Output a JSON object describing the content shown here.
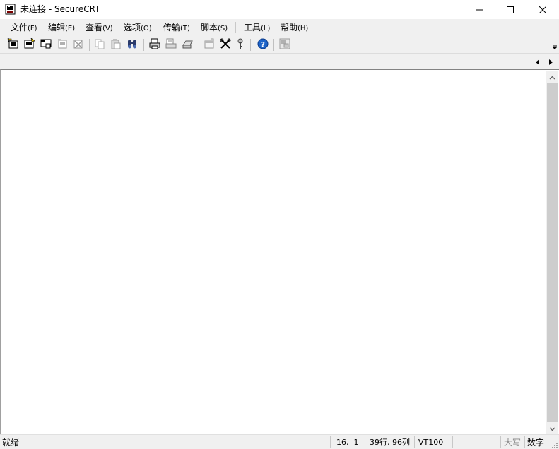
{
  "window": {
    "title": "未连接 - SecureCRT",
    "icon": "securecrt-app-icon",
    "controls": [
      "minimize-icon",
      "maximize-icon",
      "close-icon"
    ]
  },
  "menu": {
    "file": {
      "label": "文件",
      "hotkey": "(F)"
    },
    "edit": {
      "label": "编辑",
      "hotkey": "(E)"
    },
    "view": {
      "label": "查看",
      "hotkey": "(V)"
    },
    "options": {
      "label": "选项",
      "hotkey": "(O)"
    },
    "transfer": {
      "label": "传输",
      "hotkey": "(T)"
    },
    "script": {
      "label": "脚本",
      "hotkey": "(S)"
    },
    "tools": {
      "label": "工具",
      "hotkey": "(L)"
    },
    "help": {
      "label": "帮助",
      "hotkey": "(H)"
    }
  },
  "toolbar": {
    "icons": [
      "connect-icon",
      "quick-connect-icon",
      "connect-in-tab-icon",
      "reconnect-icon",
      "disconnect-icon",
      "copy-icon",
      "paste-icon",
      "find-icon",
      "print-icon",
      "print-selection-icon",
      "print-setup-icon",
      "session-options-icon",
      "global-options-icon",
      "keymap-icon",
      "help-icon",
      "sftp-icon"
    ]
  },
  "status": {
    "ready": "就绪",
    "cursor": "16,  1",
    "size": "39行, 96列",
    "emulation": "VT100",
    "caps": "大写",
    "num": "数字"
  },
  "colors": {
    "chrome": "#f0f0f0",
    "terminal_bg": "#ffffff",
    "scroll_thumb": "#cdcdcd",
    "help_blue": "#1e64c8"
  }
}
